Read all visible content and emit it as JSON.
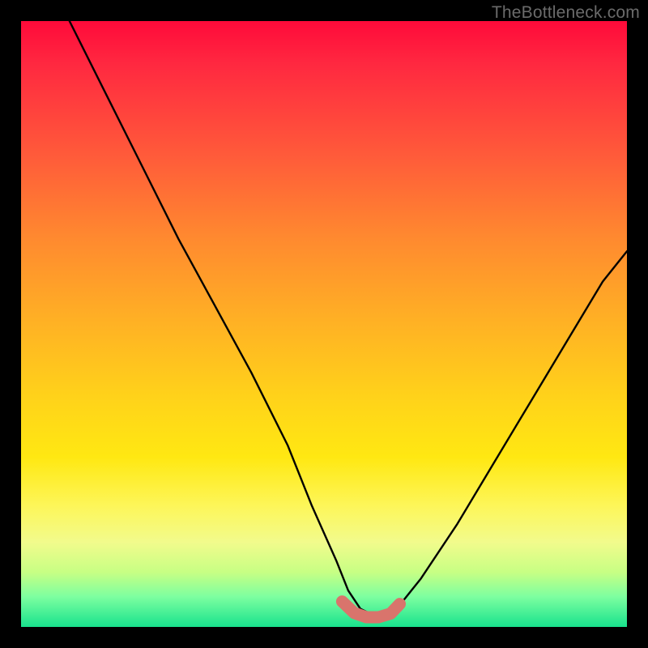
{
  "watermark": "TheBottleneck.com",
  "chart_data": {
    "type": "line",
    "title": "",
    "xlabel": "",
    "ylabel": "",
    "xlim": [
      0,
      100
    ],
    "ylim": [
      0,
      100
    ],
    "series": [
      {
        "name": "bottleneck-curve",
        "x": [
          8,
          14,
          20,
          26,
          32,
          38,
          44,
          48,
          52,
          54,
          56,
          58,
          60,
          62,
          66,
          72,
          78,
          84,
          90,
          96,
          100
        ],
        "values": [
          100,
          88,
          76,
          64,
          53,
          42,
          30,
          20,
          11,
          6,
          3,
          2,
          2,
          3,
          8,
          17,
          27,
          37,
          47,
          57,
          62
        ]
      }
    ],
    "highlight": {
      "name": "optimal-zone",
      "x": [
        53,
        55,
        57,
        59,
        61,
        62.5
      ],
      "values": [
        4.2,
        2.3,
        1.6,
        1.6,
        2.2,
        3.8
      ],
      "color": "#d9746c"
    },
    "colors": {
      "curve": "#000000",
      "highlight": "#d9746c",
      "gradient_top": "#ff0a3a",
      "gradient_bottom": "#18e28d"
    }
  }
}
